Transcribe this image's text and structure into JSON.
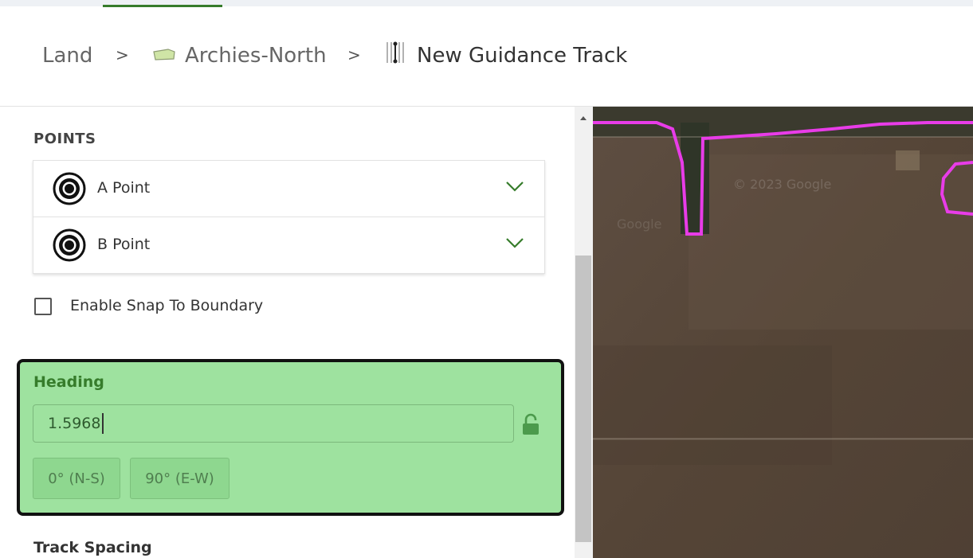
{
  "breadcrumb": {
    "land": "Land",
    "field": "Archies-North",
    "track": "New Guidance Track",
    "separator": ">"
  },
  "points": {
    "title": "POINTS",
    "items": [
      {
        "label": "A Point",
        "icon": "target-point-icon"
      },
      {
        "label": "B Point",
        "icon": "target-point-icon"
      }
    ]
  },
  "snap": {
    "label": "Enable Snap To Boundary",
    "checked": false
  },
  "heading": {
    "title": "Heading",
    "value": "1.5968",
    "locked": false,
    "buttons": [
      "0° (N-S)",
      "90° (E-W)"
    ]
  },
  "track_spacing": {
    "title": "Track Spacing"
  },
  "map": {
    "watermark": "© 2023 Google",
    "watermark_2": "Google",
    "boundary_color": "#e83ce8"
  },
  "colors": {
    "accent": "#367c2b",
    "highlight": "#9ee29f",
    "field_icon_fill": "#cfe5a6"
  }
}
